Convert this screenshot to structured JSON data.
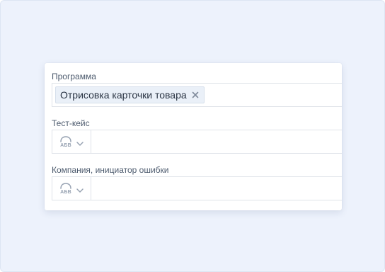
{
  "form": {
    "fields": [
      {
        "label": "Программа",
        "chips": [
          {
            "text": "Отрисовка карточки товара"
          }
        ]
      },
      {
        "label": "Тест-кейс",
        "type_picker": {
          "icon": "text-type-icon",
          "icon_text": "АБВ"
        }
      },
      {
        "label": "Компания, инициатор ошибки",
        "type_picker": {
          "icon": "text-type-icon",
          "icon_text": "АБВ"
        }
      }
    ]
  },
  "colors": {
    "background": "#edf2fc",
    "card": "#ffffff",
    "chip_bg": "#eaf0f8",
    "text": "#2b3544",
    "label": "#4d5b6e",
    "icon": "#97a2b2"
  }
}
